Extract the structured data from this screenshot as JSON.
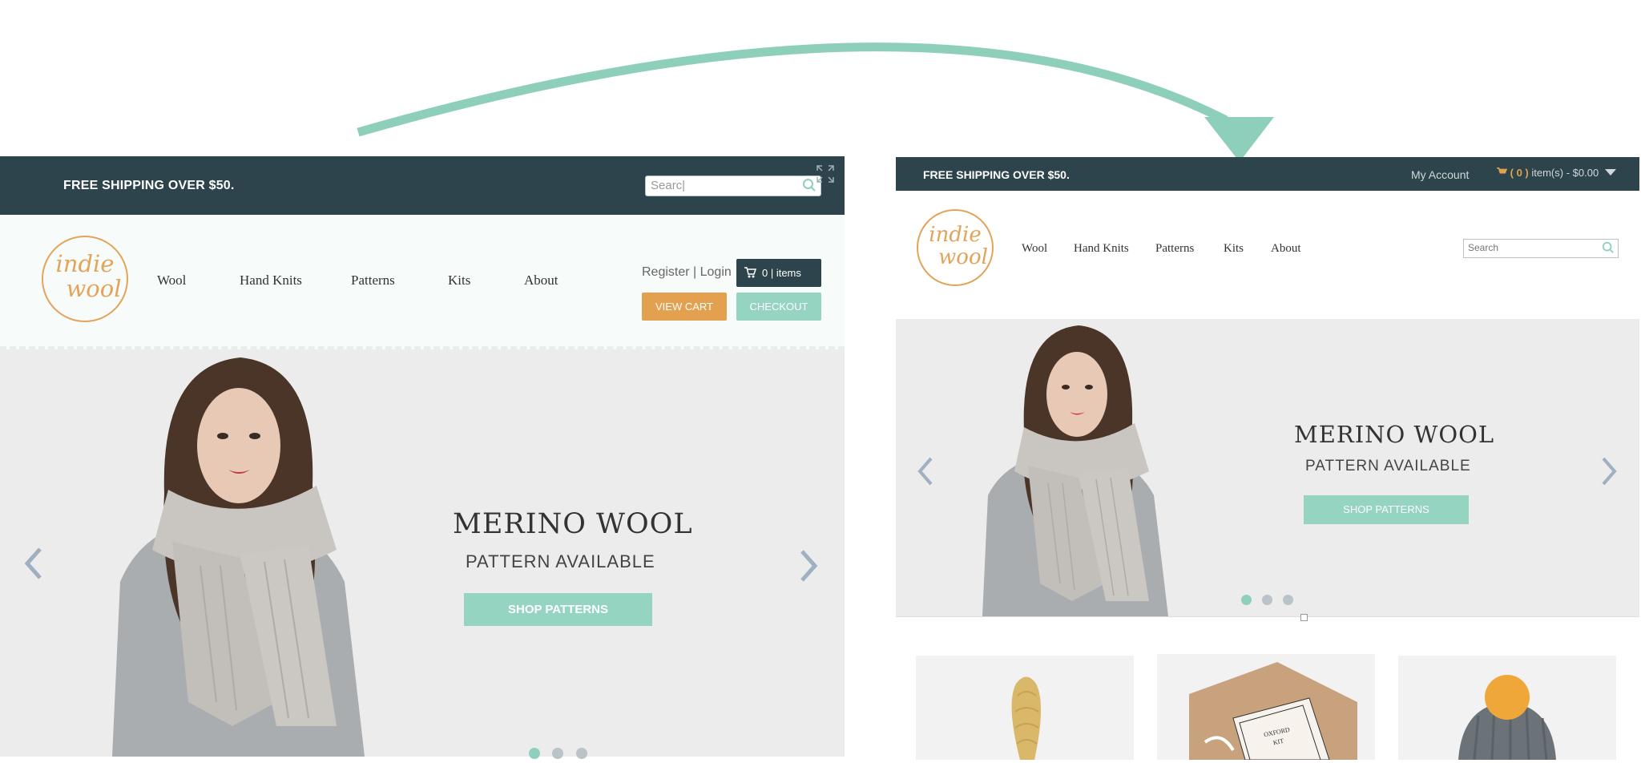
{
  "old_site": {
    "topbar": {
      "shipping": "FREE SHIPPING OVER $50.",
      "search_placeholder": "Searc|"
    },
    "logo": {
      "line1": "indie",
      "line2": "wool"
    },
    "nav": [
      "Wool",
      "Hand Knits",
      "Patterns",
      "Kits",
      "About"
    ],
    "account": {
      "register_login": "Register | Login"
    },
    "cart": {
      "items_label": "0 | items",
      "view_cart": "VIEW CART",
      "checkout": "CHECKOUT"
    },
    "hero": {
      "title": "MERINO WOOL",
      "subtitle": "PATTERN AVAILABLE",
      "button": "SHOP PATTERNS",
      "slides": 3,
      "active_slide": 1
    }
  },
  "new_site": {
    "topbar": {
      "shipping": "FREE SHIPPING OVER $50.",
      "my_account": "My Account",
      "cart_count": "( 0 )",
      "cart_summary": "item(s) - $0.00"
    },
    "logo": {
      "line1": "indie",
      "line2": "wool"
    },
    "nav": [
      "Wool",
      "Hand Knits",
      "Patterns",
      "Kits",
      "About"
    ],
    "search_placeholder": "Search",
    "hero": {
      "title": "MERINO WOOL",
      "subtitle": "PATTERN AVAILABLE",
      "button": "SHOP PATTERNS",
      "slides": 3,
      "active_slide": 1
    },
    "products": [
      "yarn-skein",
      "oxford-kit",
      "pom-pom-hat"
    ],
    "kit_label": {
      "line1": "OXFORD",
      "line2": "KIT"
    }
  },
  "colors": {
    "dark_teal": "#2e444c",
    "mint": "#94d4c1",
    "orange": "#e3a14f",
    "arrow": "#8ecfbb"
  },
  "icons": [
    "search-icon",
    "expand-icon",
    "cart-icon",
    "chevron-left-icon",
    "chevron-right-icon",
    "dropdown-caret-icon"
  ]
}
